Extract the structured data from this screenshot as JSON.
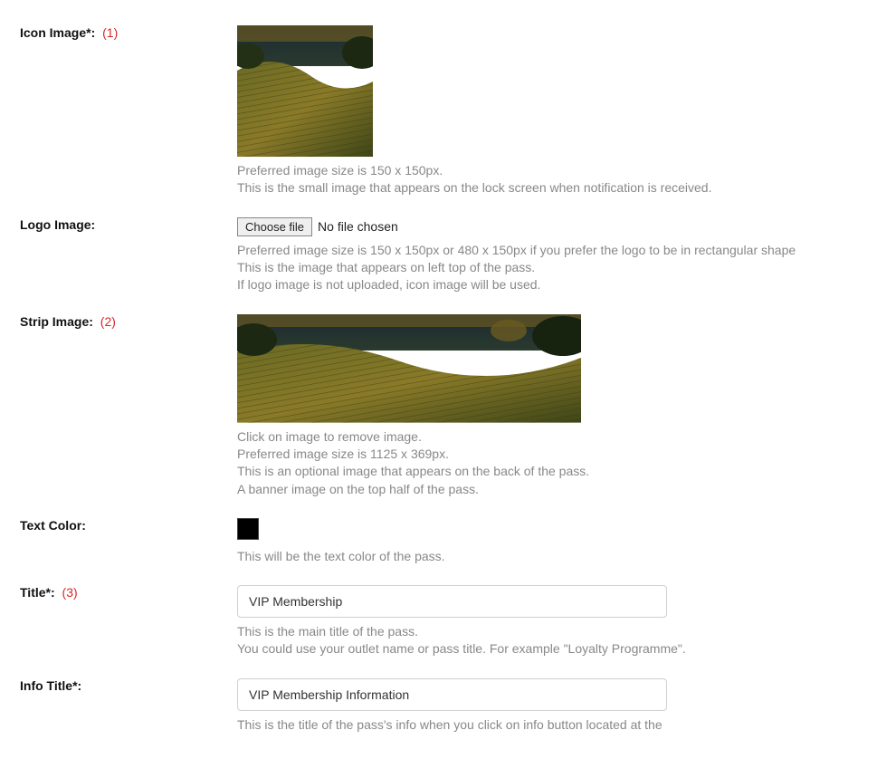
{
  "fields": {
    "icon_image": {
      "label": "Icon Image*:",
      "annot": "(1)",
      "help": [
        "Preferred image size is 150 x 150px.",
        "This is the small image that appears on the lock screen when notification is received."
      ]
    },
    "logo_image": {
      "label": "Logo Image:",
      "file_button": "Choose file",
      "file_status": "No file chosen",
      "help": [
        "Preferred image size is 150 x 150px or 480 x 150px if you prefer the logo to be in rectangular shape",
        "This is the image that appears on left top of the pass.",
        "If logo image is not uploaded, icon image will be used."
      ]
    },
    "strip_image": {
      "label": "Strip Image:",
      "annot": "(2)",
      "help": [
        "Click on image to remove image.",
        "Preferred image size is 1125 x 369px.",
        "This is an optional image that appears on the back of the pass.",
        "A banner image on the top half of the pass."
      ]
    },
    "text_color": {
      "label": "Text Color:",
      "value": "#000000",
      "help": [
        "This will be the text color of the pass."
      ]
    },
    "title": {
      "label": "Title*:",
      "annot": "(3)",
      "value": "VIP Membership",
      "help": [
        "This is the main title of the pass.",
        "You could use your outlet name or pass title. For example \"Loyalty Programme\"."
      ]
    },
    "info_title": {
      "label": "Info Title*:",
      "value": "VIP Membership Information",
      "help": [
        "This is the title of the pass's info when you click on info button located at the"
      ]
    }
  }
}
